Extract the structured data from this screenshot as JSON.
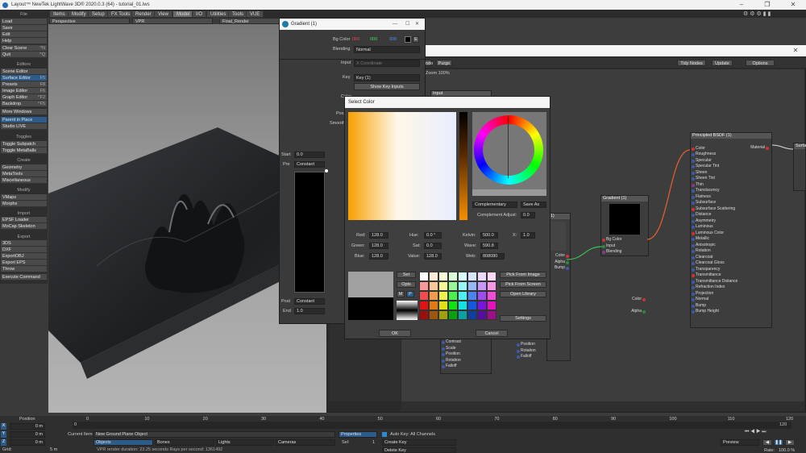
{
  "app": {
    "title": "Layout™ NewTek LightWave 3D® 2020.0.3 (64) - tutorial_01.lws"
  },
  "menu_tabs": [
    "Items",
    "Modify",
    "Setup",
    "FX Tools",
    "Render",
    "View",
    "Model",
    "I/O",
    "Utilities",
    "Tools",
    "VUE"
  ],
  "left": {
    "file_header": "File",
    "load": "Load",
    "save": "Save",
    "edit": "Edit",
    "help": "Help",
    "clear_scene": "Clear Scene",
    "clear_scene_sc": "^N",
    "quit": "Quit",
    "quit_sc": "^Q",
    "editors_header": "Editors",
    "scene_editor": "Scene Editor",
    "surface_editor": "Surface Editor",
    "surface_editor_sc": "F5",
    "presets": "Presets",
    "presets_sc": "F8",
    "image_editor": "Image Editor",
    "image_editor_sc": "F6",
    "graph_editor": "Graph Editor",
    "graph_editor_sc": "^F2",
    "backdrop": "Backdrop",
    "backdrop_sc": "^F5",
    "more_windows": "More Windows",
    "parent_in_place": "Parent in Place",
    "studio_live": "Studio LIVE",
    "toggles_header": "Toggles",
    "toggle_subpatch": "Toggle Subpatch",
    "toggle_metaballs": "Toggle MetaBalls",
    "create_header": "Create",
    "geometry": "Geometry",
    "metatools": "MetaTools",
    "miscellaneous": "Miscellaneous",
    "modify_header": "Modify",
    "vmaps": "VMaps",
    "morphs": "Morphs",
    "import_header": "Import",
    "epsf_loader": "EPSF Loader",
    "mocap_skeleton": "MoCap Skeleton",
    "export_header": "Export",
    "3ds": "3DS",
    "dxf": "DXF",
    "exportobj": "ExportOBJ",
    "export_eps": "Export EPS",
    "throw": "Throw",
    "execute_command": "Execute Command"
  },
  "viewport": {
    "view": "Perspective",
    "render": "VPR",
    "camera_mode": "Final_Render"
  },
  "gradient": {
    "title": "Gradient (1)",
    "bg_color_label": "Bg Color",
    "bg_r": "000",
    "bg_g": "000",
    "bg_b": "000",
    "blending_label": "Blending",
    "blending": "Normal",
    "input_label": "Input",
    "input": "X Coordinate",
    "key_label": "Key",
    "key_value": "Key (1)",
    "show_key_inputs": "Show Key Inputs",
    "color_label": "Color",
    "pos_label": "Pos",
    "smooth_label": "Smooth",
    "start_label": "Start",
    "start": "0.0",
    "pre_label": "Pre",
    "pre": "Constant",
    "post_label": "Post",
    "post": "Constant",
    "end_label": "End",
    "end": "1.0"
  },
  "node_editor": {
    "toolbar": {
      "undo": "Undo",
      "purge": "Purge",
      "tidy_nodes": "Tidy Nodes",
      "update": "Update",
      "options": "Options"
    },
    "zoom": "Zoom 100%",
    "nodes": {
      "input": {
        "title": "Input"
      },
      "gradient": {
        "title": "Gradient (1)",
        "ports": [
          "Bg Color",
          "Input",
          "Blending"
        ],
        "outputs": [
          "Color",
          "Alpha"
        ]
      },
      "tex": {
        "title": "(1)",
        "outputs": [
          "Color",
          "Alpha",
          "Bump"
        ]
      },
      "principled": {
        "title": "Principled BSDF (1)",
        "output": "Material",
        "inputs": [
          "Color",
          "Roughness",
          "Specular",
          "Specular Tint",
          "Sheen",
          "Sheen Tint",
          "Thin",
          "Translucency",
          "Flatness",
          "Subsurface",
          "Subsurface Scattering",
          "Distance",
          "Asymmetry",
          "Luminous",
          "Luminous Color",
          "Metallic",
          "Anisotropic",
          "Rotation",
          "Clearcoat",
          "Clearcoat Gloss",
          "Transparency",
          "Transmittance",
          "Transmittance Distance",
          "Refraction Index",
          "Projection",
          "Normal",
          "Bump",
          "Bump Height"
        ]
      },
      "surface": {
        "title": "Surfa..."
      },
      "transform_a": {
        "ports": [
          "Contrast",
          "Scale",
          "Position",
          "Rotation",
          "Falloff"
        ]
      },
      "transform_b": {
        "ports": [
          "Position",
          "Rotation",
          "Falloff"
        ]
      }
    }
  },
  "select_color": {
    "title": "Select Color",
    "harmony": "Complementary",
    "save_as": "Save As",
    "complement_adjust_label": "Complement Adjust:",
    "complement_adjust": "0.0",
    "red_label": "Red:",
    "red": "128.0",
    "hue_label": "Hue:",
    "hue": "0.0 °",
    "kelvin_label": "Kelvin:",
    "kelvin": "500.0",
    "x_label": "X:",
    "x": "1.0",
    "green_label": "Green:",
    "green": "128.0",
    "sat_label": "Sat:",
    "sat": "0.0",
    "wave_label": "Wave:",
    "wave": "590.8",
    "blue_label": "Blue:",
    "blue": "128.0",
    "value_label": "Value:",
    "value": "128.0",
    "web_label": "Web:",
    "web": "808080",
    "set": "Set",
    "opts": "Opts",
    "m": "M",
    "p": "P",
    "pick_from_image": "Pick From Image",
    "pick_from_screen": "Pick From Screen",
    "open_library": "Open Library",
    "settings": "Settings",
    "ok": "OK",
    "cancel": "Cancel"
  },
  "timeline": {
    "position_label": "Position",
    "x_label": "X",
    "y_label": "Y",
    "z_label": "Z",
    "x_val": "0 m",
    "y_val": "0 m",
    "z_val": "0 m",
    "grid_label": "Grid:",
    "grid": "5 m",
    "ticks": [
      "0",
      "10",
      "20",
      "30",
      "40",
      "50",
      "60",
      "70",
      "80",
      "90",
      "100",
      "110",
      "120"
    ],
    "start_frame": "0",
    "end_frame": "120",
    "current_item_label": "Current Item",
    "current_item": "New Ground Plane Object",
    "objects": "Objects",
    "bones": "Bones",
    "lights": "Lights",
    "cameras": "Cameras",
    "properties": "Properties",
    "sel_label": "Sel:",
    "sel": "1",
    "auto_key": "Auto Key: All Channels",
    "create_key": "Create Key",
    "delete_key": "Delete Key",
    "status": "VPR render duration: 23.25 seconds  Rays per second: 1361492",
    "preview": "Preview",
    "rate_label": "Rate:",
    "rate": "100.0 %"
  }
}
